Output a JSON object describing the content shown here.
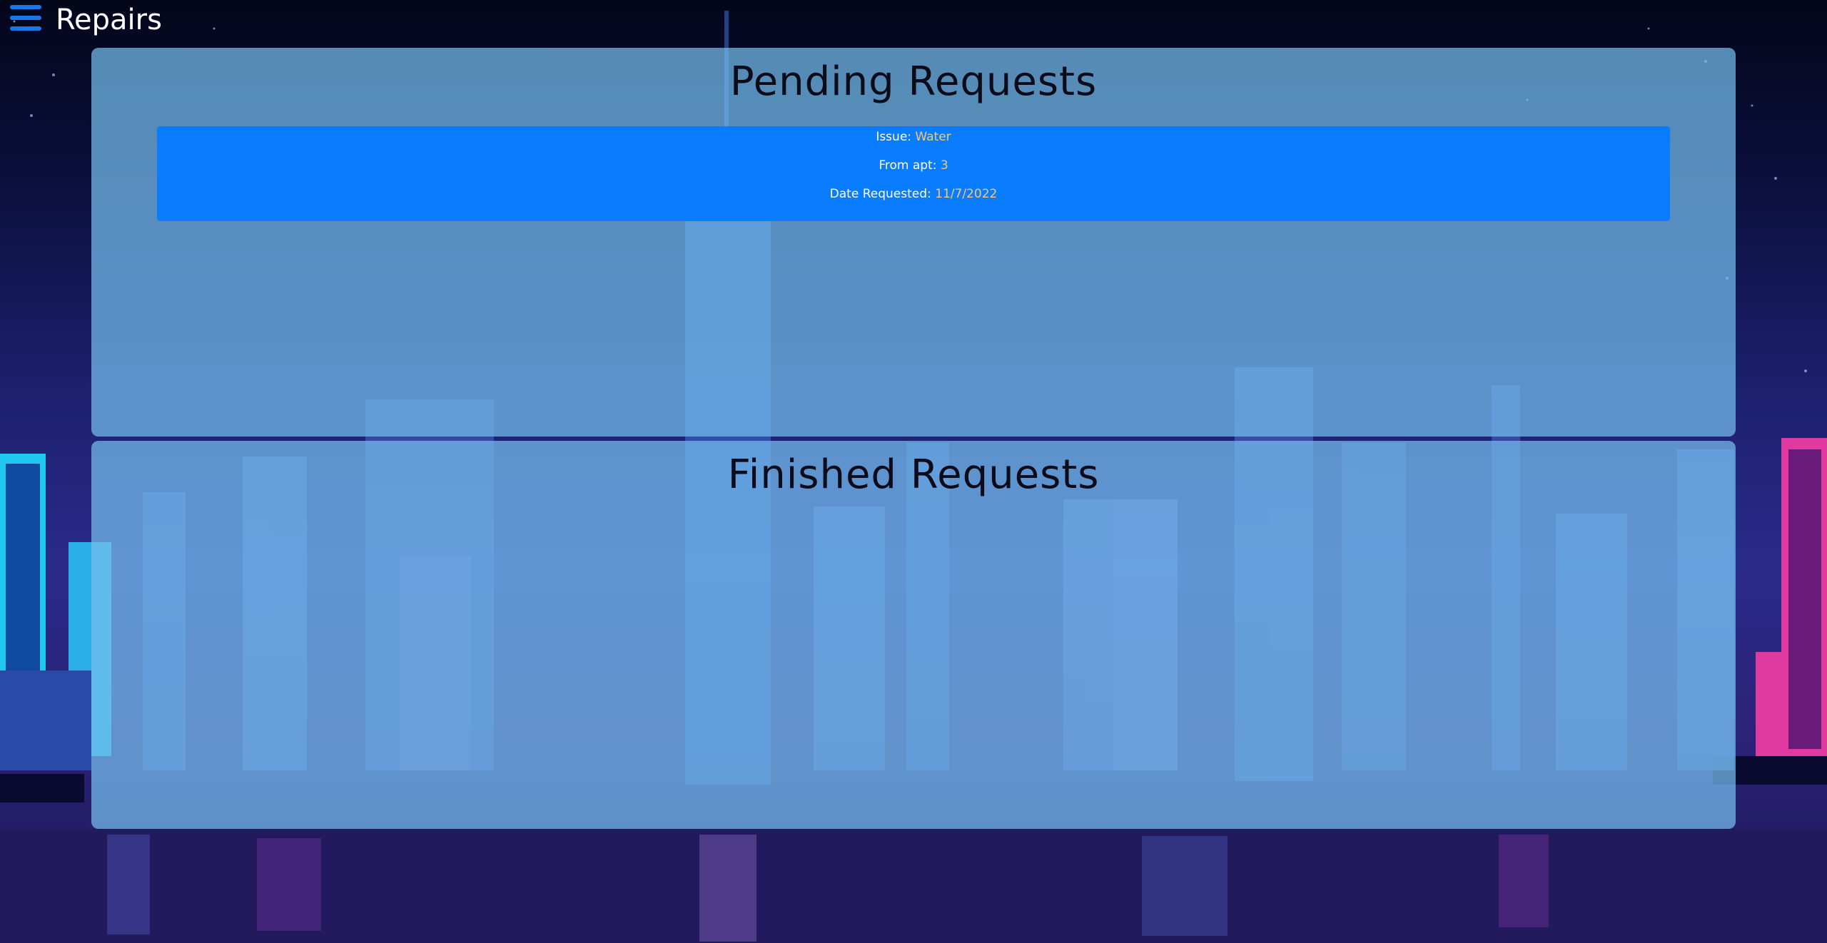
{
  "header": {
    "menu_icon": "hamburger-menu-icon",
    "title": "Repairs"
  },
  "pending": {
    "title": "Pending Requests",
    "requests": [
      {
        "issue_label": "Issue: ",
        "issue": "Water",
        "apt_label": "From apt: ",
        "apt": "3",
        "date_label": "Date Requested: ",
        "date": "11/7/2022"
      }
    ]
  },
  "finished": {
    "title": "Finished Requests",
    "requests": []
  },
  "colors": {
    "accent": "#0a7cff",
    "menu_icon": "#1878e8",
    "value_text": "#f4c96a",
    "panel": "#76beee"
  }
}
